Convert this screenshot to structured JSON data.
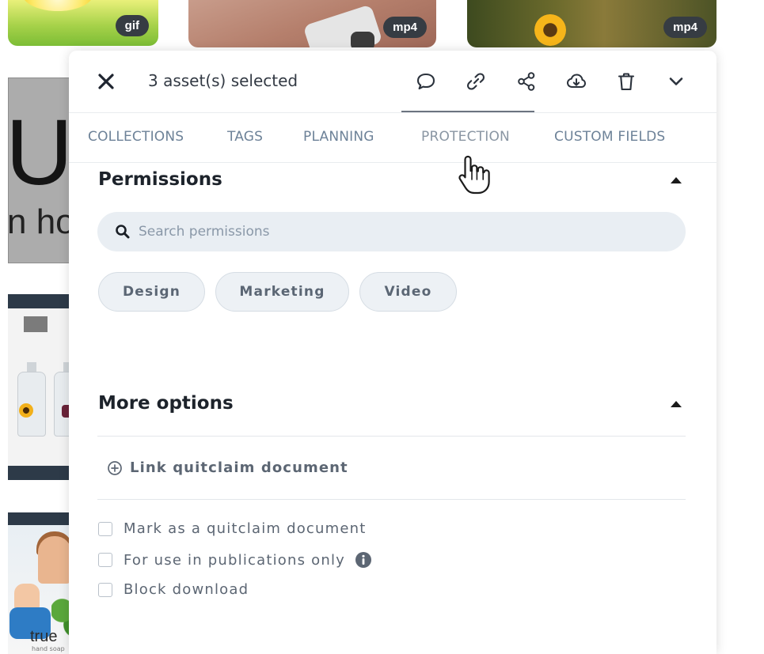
{
  "background": {
    "thumbnails": [
      {
        "badge": "gif"
      },
      {
        "badge": "mp4"
      },
      {
        "badge": "mp4"
      }
    ],
    "tile_text": {
      "big_letter": "U",
      "small_text": "n ho",
      "brand": "true",
      "brand_sub": "hand soap"
    }
  },
  "panel": {
    "selection_text": "3 asset(s) selected",
    "toolbar_icons": [
      "comment-icon",
      "link-icon",
      "share-icon",
      "download-cloud-icon",
      "trash-icon",
      "chevron-down-icon"
    ],
    "tabs": [
      {
        "label": "COLLECTIONS"
      },
      {
        "label": "TAGS"
      },
      {
        "label": "PLANNING"
      },
      {
        "label": "PROTECTION",
        "active": true
      },
      {
        "label": "CUSTOM FIELDS"
      }
    ],
    "permissions": {
      "title": "Permissions",
      "search_placeholder": "Search permissions",
      "chips": [
        "Design",
        "Marketing",
        "Video"
      ]
    },
    "more_options": {
      "title": "More options",
      "link_label": "Link quitclaim document",
      "checkboxes": [
        {
          "label": "Mark as a quitclaim document",
          "checked": false
        },
        {
          "label": "For use in publications only",
          "checked": false,
          "info_icon": true
        },
        {
          "label": "Block download",
          "checked": false
        }
      ]
    }
  },
  "colors": {
    "tab_text": "#6d8298",
    "chip_bg": "#edf1f5",
    "search_bg": "#e9eef3",
    "badge_bg": "#363c43"
  }
}
